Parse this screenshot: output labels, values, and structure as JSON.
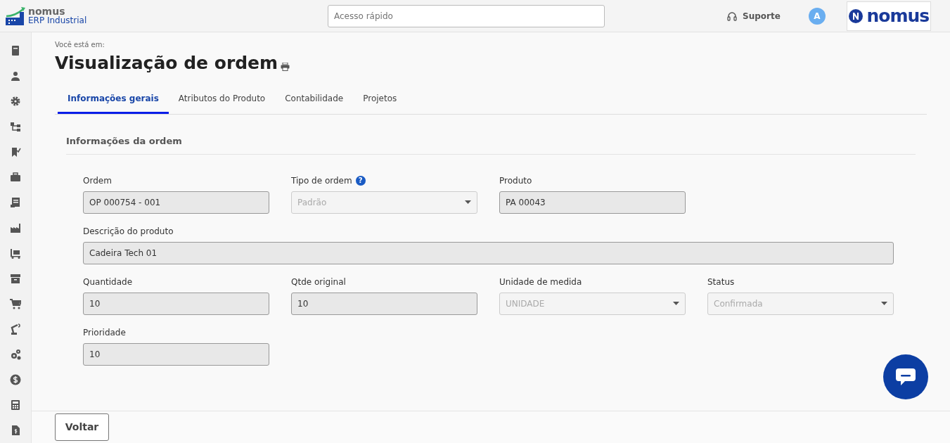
{
  "header": {
    "logo_top": "nomus",
    "logo_bottom": "ERP Industrial",
    "search": {
      "placeholder": "Acesso rápido"
    },
    "support": "Suporte",
    "avatar": "A",
    "brand": "nomus"
  },
  "breadcrumb": "Você está em:",
  "title": "Visualização de ordem",
  "tabs": [
    {
      "label": "Informações gerais",
      "selected": true
    },
    {
      "label": "Atributos do Produto",
      "selected": false
    },
    {
      "label": "Contabilidade",
      "selected": false
    },
    {
      "label": "Projetos",
      "selected": false
    }
  ],
  "section": {
    "title": "Informações da ordem",
    "rows": [
      [
        {
          "label": "Ordem",
          "value": "OP 000754 - 001",
          "kind": "input"
        },
        {
          "label": "Tipo de ordem",
          "help": "?",
          "value": "Padrão",
          "kind": "select"
        },
        {
          "label": "Produto",
          "value": "PA 00043",
          "kind": "input"
        }
      ],
      [
        {
          "label": "Descrição do produto",
          "value": "Cadeira Tech 01",
          "kind": "wide"
        }
      ],
      [
        {
          "label": "Quantidade",
          "value": "10",
          "kind": "input"
        },
        {
          "label": "Qtde original",
          "value": "10",
          "kind": "input"
        },
        {
          "label": "Unidade de medida",
          "value": "UNIDADE",
          "kind": "select"
        },
        {
          "label": "Status",
          "value": "Confirmada",
          "kind": "select"
        }
      ],
      [
        {
          "label": "Prioridade",
          "value": "10",
          "kind": "input"
        }
      ]
    ]
  },
  "footer": {
    "back_button": "Voltar"
  }
}
